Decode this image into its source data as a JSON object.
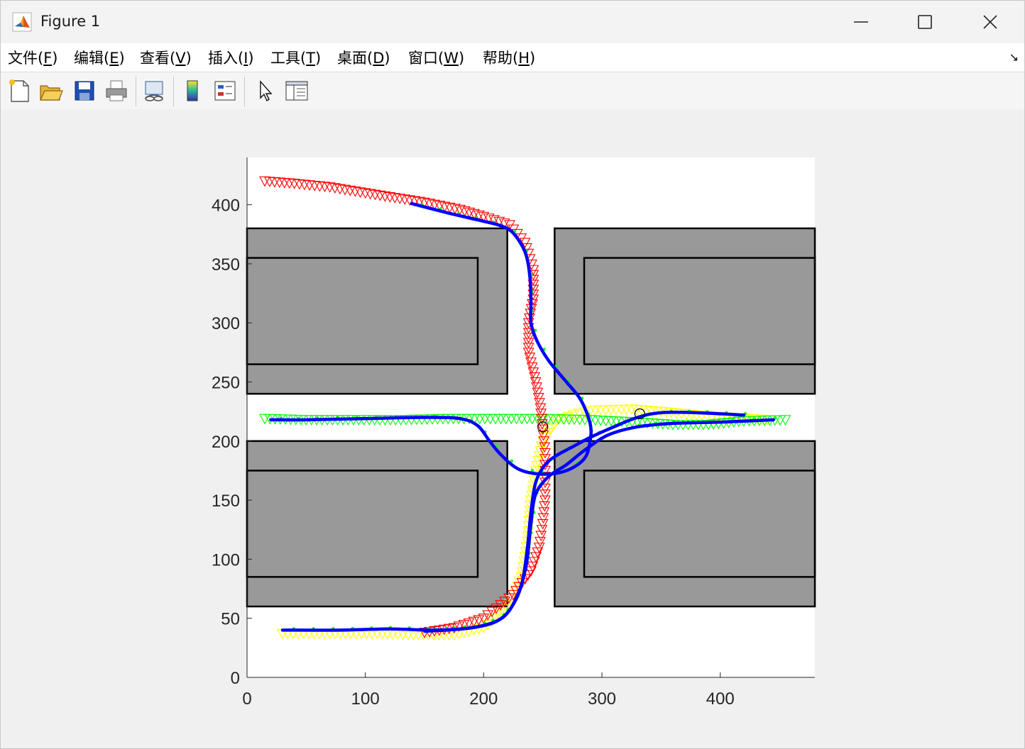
{
  "window": {
    "title": "Figure 1",
    "icon": "matlab-icon",
    "controls": [
      "minimize-icon",
      "maximize-icon",
      "close-icon"
    ]
  },
  "menu": {
    "items": [
      {
        "text": "文件(",
        "key": "F",
        "tail": ")"
      },
      {
        "text": "编辑(",
        "key": "E",
        "tail": ")"
      },
      {
        "text": "查看(",
        "key": "V",
        "tail": ")"
      },
      {
        "text": "插入(",
        "key": "I",
        "tail": ")"
      },
      {
        "text": "工具(",
        "key": "T",
        "tail": ")"
      },
      {
        "text": "桌面(",
        "key": "D",
        "tail": ")"
      },
      {
        "text": "窗口(",
        "key": "W",
        "tail": ")"
      },
      {
        "text": "帮助(",
        "key": "H",
        "tail": ")"
      }
    ],
    "overflow_icon": "↘"
  },
  "toolbar": {
    "buttons": [
      "new-figure-icon",
      "open-file-icon",
      "save-icon",
      "print-icon",
      "link-plot-icon",
      "colorbar-icon",
      "legend-icon",
      "edit-plot-arrow-icon",
      "property-inspector-icon"
    ]
  },
  "chart_data": {
    "type": "scatter",
    "title": "",
    "xlabel": "",
    "ylabel": "",
    "xlim": [
      0,
      480
    ],
    "ylim": [
      0,
      440
    ],
    "xticks": [
      0,
      100,
      200,
      300,
      400
    ],
    "yticks": [
      0,
      50,
      100,
      150,
      200,
      250,
      300,
      350,
      400
    ],
    "grid": false,
    "colors": {
      "obstacle_fill": "#999999",
      "obstacle_edge": "#000000",
      "red_markers": "#ff0000",
      "yellow_markers": "#ffff00",
      "green_markers": "#00ff00",
      "path": "#0000ff",
      "path_dots": "#00ff00"
    },
    "obstacles": [
      {
        "outer": [
          0,
          240,
          220,
          380
        ],
        "inner": [
          0,
          265,
          195,
          355
        ]
      },
      {
        "outer": [
          260,
          240,
          480,
          380
        ],
        "inner": [
          285,
          265,
          480,
          355
        ]
      },
      {
        "outer": [
          0,
          60,
          220,
          200
        ],
        "inner": [
          0,
          85,
          195,
          175
        ]
      },
      {
        "outer": [
          260,
          60,
          480,
          200
        ],
        "inner": [
          285,
          85,
          480,
          175
        ]
      }
    ],
    "marker_series": [
      {
        "color": "red",
        "marker": "triangle-down",
        "points": [
          [
            15,
            420
          ],
          [
            40,
            418
          ],
          [
            70,
            415
          ],
          [
            100,
            410
          ],
          [
            125,
            406
          ],
          [
            150,
            402
          ],
          [
            180,
            396
          ],
          [
            200,
            390
          ],
          [
            222,
            383
          ],
          [
            235,
            368
          ],
          [
            242,
            345
          ],
          [
            242,
            320
          ],
          [
            238,
            300
          ],
          [
            238,
            275
          ],
          [
            244,
            250
          ],
          [
            248,
            228
          ],
          [
            250,
            210
          ],
          [
            252,
            190
          ],
          [
            252,
            170
          ],
          [
            252,
            150
          ],
          [
            250,
            130
          ],
          [
            247,
            110
          ],
          [
            240,
            90
          ],
          [
            225,
            70
          ],
          [
            200,
            50
          ],
          [
            175,
            42
          ],
          [
            150,
            38
          ]
        ]
      },
      {
        "color": "yellow",
        "marker": "triangle-down",
        "points": [
          [
            30,
            37
          ],
          [
            70,
            37
          ],
          [
            110,
            37
          ],
          [
            145,
            36
          ],
          [
            175,
            36
          ],
          [
            200,
            42
          ],
          [
            220,
            58
          ],
          [
            232,
            85
          ],
          [
            237,
            115
          ],
          [
            240,
            150
          ],
          [
            244,
            175
          ],
          [
            250,
            200
          ],
          [
            262,
            218
          ],
          [
            290,
            226
          ],
          [
            325,
            227
          ],
          [
            350,
            225
          ],
          [
            380,
            222
          ],
          [
            410,
            220
          ],
          [
            440,
            218
          ]
        ]
      },
      {
        "color": "green",
        "marker": "triangle-down",
        "points": [
          [
            15,
            219
          ],
          [
            50,
            218
          ],
          [
            90,
            218
          ],
          [
            130,
            218
          ],
          [
            170,
            219
          ],
          [
            210,
            219
          ],
          [
            250,
            219
          ],
          [
            290,
            218
          ],
          [
            330,
            216
          ],
          [
            360,
            214
          ],
          [
            390,
            214
          ],
          [
            420,
            217
          ],
          [
            455,
            218
          ]
        ]
      }
    ],
    "paths": [
      {
        "points": [
          [
            139,
            401
          ],
          [
            170,
            393
          ],
          [
            200,
            386
          ],
          [
            215,
            382
          ],
          [
            225,
            376
          ],
          [
            235,
            360
          ],
          [
            239,
            340
          ],
          [
            240,
            318
          ],
          [
            240,
            300
          ],
          [
            245,
            285
          ],
          [
            255,
            268
          ],
          [
            270,
            250
          ],
          [
            282,
            235
          ],
          [
            290,
            215
          ],
          [
            290,
            200
          ],
          [
            285,
            185
          ],
          [
            270,
            175
          ],
          [
            250,
            172
          ],
          [
            230,
            176
          ],
          [
            215,
            188
          ],
          [
            205,
            200
          ],
          [
            195,
            213
          ],
          [
            180,
            219
          ],
          [
            150,
            220
          ],
          [
            100,
            219
          ],
          [
            50,
            218
          ],
          [
            20,
            218
          ]
        ]
      },
      {
        "points": [
          [
            30,
            40
          ],
          [
            80,
            40
          ],
          [
            120,
            41
          ],
          [
            160,
            40
          ],
          [
            190,
            42
          ],
          [
            210,
            47
          ],
          [
            222,
            57
          ],
          [
            232,
            78
          ],
          [
            237,
            110
          ],
          [
            240,
            140
          ],
          [
            244,
            165
          ],
          [
            252,
            180
          ],
          [
            262,
            188
          ],
          [
            275,
            195
          ],
          [
            290,
            203
          ],
          [
            310,
            212
          ],
          [
            330,
            220
          ],
          [
            350,
            224
          ],
          [
            380,
            224
          ],
          [
            420,
            222
          ]
        ]
      },
      {
        "points": [
          [
            150,
            39
          ],
          [
            190,
            42
          ],
          [
            215,
            50
          ],
          [
            228,
            68
          ],
          [
            236,
            95
          ],
          [
            240,
            130
          ],
          [
            244,
            155
          ],
          [
            255,
            170
          ],
          [
            270,
            180
          ],
          [
            285,
            192
          ],
          [
            305,
            205
          ],
          [
            330,
            212
          ],
          [
            360,
            215
          ],
          [
            400,
            216
          ],
          [
            445,
            218
          ]
        ]
      }
    ],
    "circles": [
      [
        250,
        212
      ],
      [
        332,
        223
      ]
    ]
  }
}
